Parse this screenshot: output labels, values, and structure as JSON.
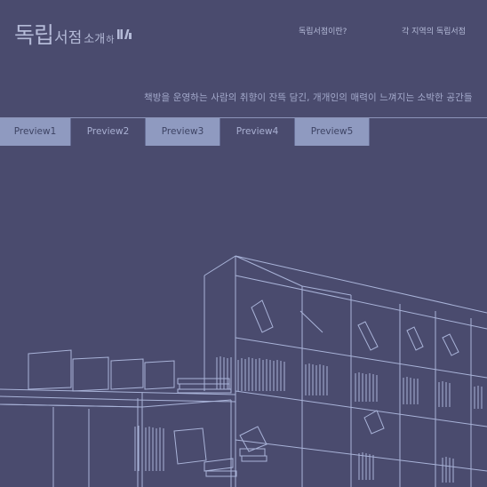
{
  "header": {
    "logo": {
      "big": "독립",
      "mid": "서점",
      "small": "소개",
      "sm2": "하",
      "mark_icon": "book-stack-icon"
    },
    "nav": [
      {
        "label": "독립서점이란?"
      },
      {
        "label": "각 지역의 독립서점"
      }
    ]
  },
  "tagline": "책방을 운영하는 사람의 취향이 잔뜩 담긴, 개개인의 매력이 느껴지는 소박한 공간들",
  "tabs": [
    {
      "label": "Preview1"
    },
    {
      "label": "Preview2"
    },
    {
      "label": "Preview3"
    },
    {
      "label": "Preview4"
    },
    {
      "label": "Preview5"
    }
  ],
  "colors": {
    "background": "#4a4b6e",
    "tab_light": "#8f9ac0",
    "line": "#aab4d8"
  }
}
